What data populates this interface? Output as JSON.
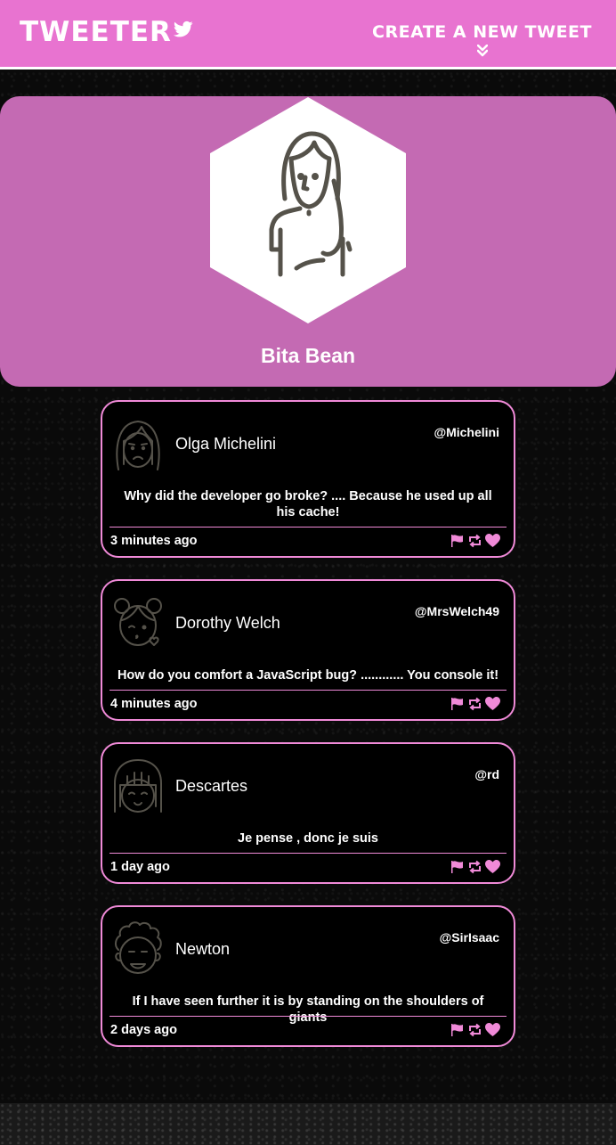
{
  "navbar": {
    "brand": "TWEETER",
    "compose_label": "CREATE A NEW TWEET",
    "accent": "#e873d0"
  },
  "profile": {
    "name": "Bita Bean",
    "background": "#c46ab3"
  },
  "tweets": [
    {
      "name": "Olga Michelini",
      "handle": "@Michelini",
      "content": "Why did the developer go broke? .... Because he used up all his cache!",
      "time": "3 minutes ago",
      "avatar_icon": "sad-girl-avatar-icon"
    },
    {
      "name": "Dorothy Welch",
      "handle": "@MrsWelch49",
      "content": "How do you comfort a JavaScript bug? ............ You console it!",
      "time": "4 minutes ago",
      "avatar_icon": "kissing-girl-avatar-icon"
    },
    {
      "name": "Descartes",
      "handle": "@rd",
      "content": "Je pense , donc je suis",
      "time": "1 day ago",
      "avatar_icon": "smiling-bob-avatar-icon"
    },
    {
      "name": "Newton",
      "handle": "@SirIsaac",
      "content": "If I have seen further it is by standing on the shoulders of giants",
      "time": "2 days ago",
      "avatar_icon": "curly-hair-avatar-icon"
    }
  ],
  "action_icons": [
    "flag-icon",
    "retweet-icon",
    "heart-icon"
  ],
  "colors": {
    "tweet_border": "#f08ad8",
    "action_icon": "#f08ad8",
    "avatar_stroke": "#55524a"
  }
}
